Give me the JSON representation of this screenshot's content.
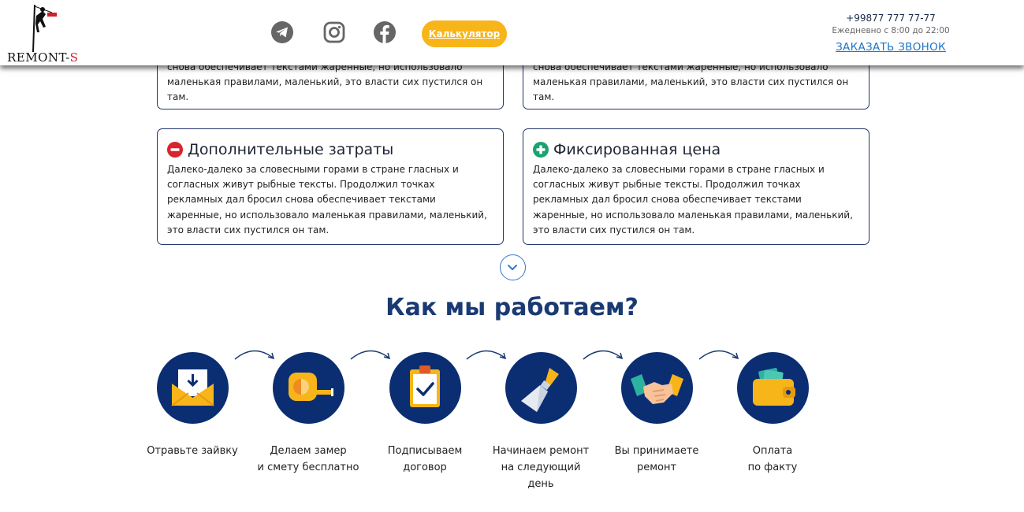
{
  "header": {
    "logo_main": "REMONT-",
    "logo_accent": "S",
    "calculator_label": "Калькулятор",
    "phone": "+99877 777 77-77",
    "hours": "Ежедневно с 8:00 до 22:00",
    "callback_label": "ЗАКАЗАТЬ ЗВОНОК",
    "social_icons": [
      "telegram-icon",
      "instagram-icon",
      "facebook-icon"
    ]
  },
  "cards_top": [
    {
      "text": "снова обеспечивает текстами жаренные, но использовало маленькая правилами, маленький, это власти сих пустился он там."
    },
    {
      "text": "снова обеспечивает текстами жаренные, но использовало маленькая правилами, маленький, это власти сих пустился он там."
    }
  ],
  "cards": [
    {
      "title": "Дополнительные затраты",
      "icon": "minus-circle-icon",
      "icon_color": "#d9232e",
      "text": "Далеко-далеко за словесными горами в стране гласных и согласных живут рыбные тексты. Продолжил точках рекламных дал бросил снова обеспечивает текстами жаренные, но использовало маленькая правилами, маленький, это власти сих пустился он там."
    },
    {
      "title": "Фиксированная цена",
      "icon": "plus-circle-icon",
      "icon_color": "#1aa371",
      "text": "Далеко-далеко за словесными горами в стране гласных и согласных живут рыбные тексты. Продолжил точках рекламных дал бросил снова обеспечивает текстами жаренные, но использовало маленькая правилами, маленький, это власти сих пустился он там."
    }
  ],
  "section_title": "Как мы работаем?",
  "steps": [
    {
      "icon": "envelope-icon",
      "line1": "Отравьте зайвку",
      "line2": "",
      "line3": ""
    },
    {
      "icon": "tape-measure-icon",
      "line1": "Делаем замер",
      "line2": "и смету бесплатно",
      "line3": ""
    },
    {
      "icon": "clipboard-check-icon",
      "line1": "Подписываем",
      "line2": "договор",
      "line3": ""
    },
    {
      "icon": "spatula-icon",
      "line1": "Начинаем ремонт",
      "line2": "на следующий",
      "line3": "день"
    },
    {
      "icon": "handshake-icon",
      "line1": "Вы принимаете",
      "line2": "ремонт",
      "line3": ""
    },
    {
      "icon": "wallet-icon",
      "line1": "Оплата",
      "line2": "по факту",
      "line3": ""
    }
  ],
  "colors": {
    "accent_orange": "#f7b519",
    "navy": "#0b2e72",
    "title_blue": "#1a3a73",
    "link_blue": "#1b74c9"
  }
}
